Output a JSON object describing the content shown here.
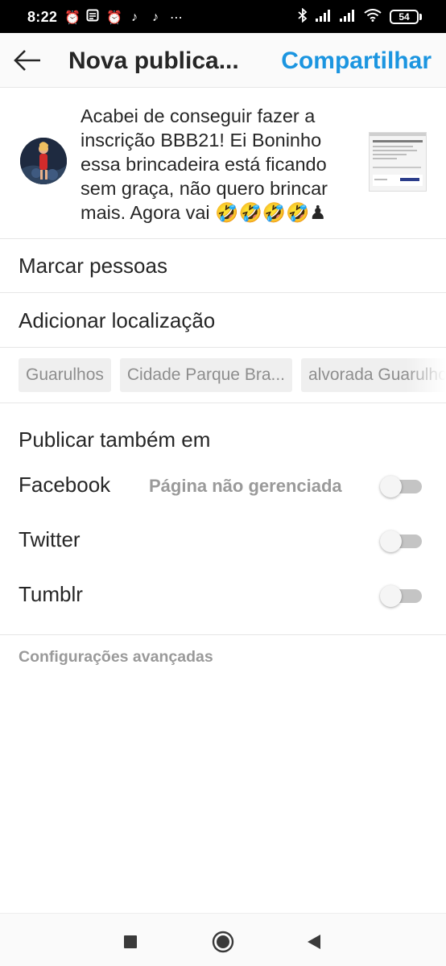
{
  "status_bar": {
    "time": "8:22",
    "battery": "54",
    "left_icons": [
      "alarm-icon",
      "notes-icon",
      "alarm-icon",
      "tiktok-icon",
      "tiktok-icon",
      "more-icon"
    ],
    "right_icons": [
      "bluetooth-icon",
      "signal-icon",
      "signal-icon",
      "wifi-icon"
    ]
  },
  "header": {
    "title": "Nova publica...",
    "share_label": "Compartilhar"
  },
  "post": {
    "caption": "Acabei de conseguir fazer a inscrição BBB21! Ei Boninho essa brincadeira está ficando sem graça, não quero brincar mais. Agora vai 🤣🤣🤣🤣♟"
  },
  "rows": {
    "tag_people": "Marcar pessoas",
    "add_location": "Adicionar localização"
  },
  "location_suggestions": [
    "Guarulhos",
    "Cidade Parque Bra...",
    "alvorada Guarulhos"
  ],
  "share_also": {
    "heading": "Publicar também em",
    "networks": [
      {
        "name": "Facebook",
        "subtitle": "Página não gerenciada",
        "enabled": false
      },
      {
        "name": "Twitter",
        "subtitle": "",
        "enabled": false
      },
      {
        "name": "Tumblr",
        "subtitle": "",
        "enabled": false
      }
    ]
  },
  "advanced_settings": "Configurações avançadas",
  "colors": {
    "accent": "#1b95e0",
    "text": "#262626",
    "muted": "#9a9a9a",
    "chip_bg": "#efefef"
  },
  "navbar": [
    "recents-square-icon",
    "home-circle-icon",
    "back-triangle-icon"
  ]
}
